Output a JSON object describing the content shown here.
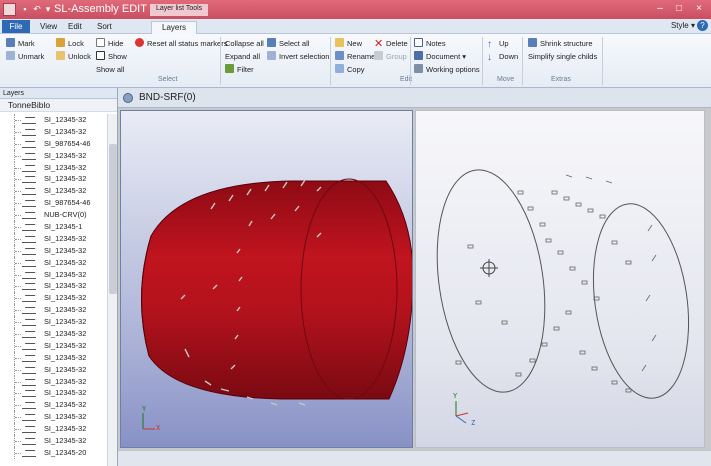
{
  "window": {
    "title": "SL-Assembly  EDIT FILE - To...",
    "context_tab": "Layer list Tools",
    "controls": [
      "–",
      "□",
      "×"
    ]
  },
  "tabs": {
    "file": "File",
    "items": [
      "View",
      "Edit",
      "Sort",
      "Layers"
    ],
    "active": "Layers",
    "style_menu": "Style ▾",
    "help": "?"
  },
  "ribbon": {
    "mark": "Mark",
    "unmark": "Unmark",
    "lock": "Lock",
    "unlock": "Unlock",
    "hide": "Hide",
    "show": "Show",
    "show_all": "Show all",
    "reset_all": "Reset all status markers",
    "select_group": "Select",
    "collapse_all": "Collapse all",
    "expand_all": "Expand all",
    "filter": "Filter",
    "select_all": "Select all",
    "invert_selection": "Invert selection",
    "new": "New",
    "rename": "Rename",
    "copy": "Copy",
    "delete": "Delete",
    "group": "Group",
    "edit_group": "Edit",
    "notes": "Notes",
    "document": "Document ▾",
    "working_options": "Working options",
    "up": "Up",
    "down": "Down",
    "move_group": "Move",
    "shrink_structure": "Shrink structure",
    "simplify_single_childs": "Simplify single childs",
    "extras_group": "Extras"
  },
  "layers_panel": {
    "header": "Layers",
    "root": "TonneBiblo",
    "items": [
      "SI_12345-32",
      "SI_12345-32",
      "SI_987654-46",
      "SI_12345-32",
      "SI_12345-32",
      "SI_12345-32",
      "SI_12345-32",
      "SI_987654-46",
      "NUB-CRV(0)",
      "SI_12345-1",
      "SI_12345-32",
      "SI_12345-32",
      "SI_12345-32",
      "SI_12345-32",
      "SI_12345-32",
      "SI_12345-32",
      "SI_12345-32",
      "SI_12345-32",
      "SI_12345-32",
      "SI_12345-32",
      "SI_12345-32",
      "SI_12345-32",
      "SI_12345-32",
      "SI_12345-32",
      "SI_12345-32",
      "SI_12345-32",
      "SI_12345-32",
      "SI_12345-32",
      "SI_12345-20"
    ]
  },
  "view": {
    "title": "BND-SRF(0)",
    "axes_shaded": {
      "y": "Y",
      "x": "X"
    },
    "axes_wire": {
      "y": "Y",
      "z": "Z"
    }
  },
  "colors": {
    "title_bar": "#d35a6c",
    "ribbon_blue": "#2e6ab3",
    "cylinder": "#b3121c"
  }
}
